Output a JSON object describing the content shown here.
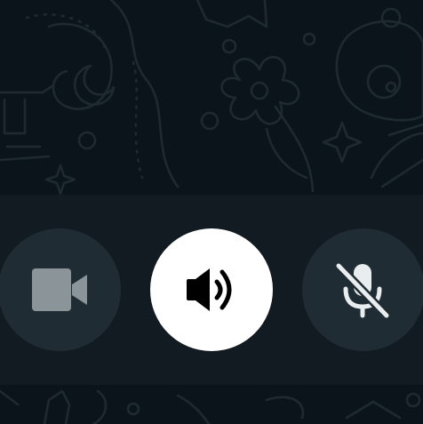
{
  "screen": {
    "name": "ongoing-voice-call-controls",
    "background_color": "#0b141a",
    "wallpaper_doodle_color": "#1e2a30"
  },
  "controls": {
    "bar_color": "#111b21",
    "buttons": [
      {
        "id": "video",
        "icon": "video-camera-icon",
        "state": "disabled",
        "background": "#202c33",
        "icon_color": "#8a9499"
      },
      {
        "id": "speaker",
        "icon": "speaker-icon",
        "state": "active",
        "background": "#ffffff",
        "icon_color": "#000000"
      },
      {
        "id": "mute",
        "icon": "microphone-muted-icon",
        "state": "inactive",
        "background": "#202c33",
        "icon_color": "#e9edef"
      }
    ]
  }
}
